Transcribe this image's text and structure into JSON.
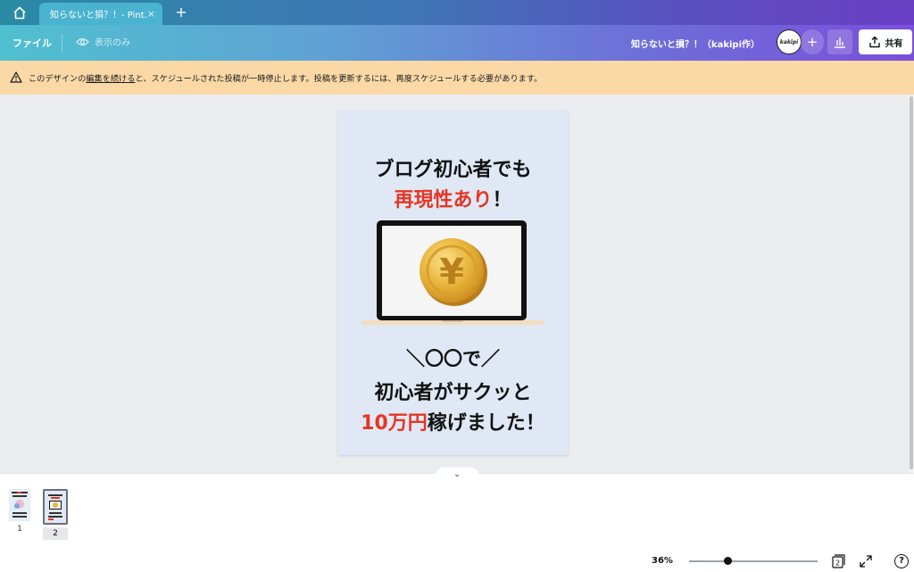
{
  "tabbar": {
    "tab_title": "知らないと損？！- Pint...",
    "tab_close": "×",
    "new_tab": "+"
  },
  "toolbar": {
    "file_label": "ファイル",
    "view_only_label": "表示のみ",
    "doc_title": "知らないと損？！（kakipi作）",
    "avatar_text": "kakipi",
    "add_collaborator": "+",
    "share_label": "共有"
  },
  "banner": {
    "text_before": "このデザインの",
    "link": "編集を続ける",
    "text_after": "と、スケジュールされた投稿が一時停止します。投稿を更新するには、再度スケジュールする必要があります。"
  },
  "design": {
    "line1": "ブログ初心者でも",
    "line2_red": "再現性あり",
    "line2_black": "！",
    "currency_symbol": "¥",
    "subline": "＼〇〇で／",
    "line3": "初心者がサクッと",
    "line4_red": "10万円",
    "line4_black": "稼げました！"
  },
  "pages": {
    "items": [
      {
        "number": "1"
      },
      {
        "number": "2"
      }
    ],
    "selected": "2"
  },
  "footer": {
    "zoom": "36%",
    "zoom_fraction": 0.3,
    "page_count": "2",
    "help": "?"
  },
  "colors": {
    "accent_red": "#e53524",
    "banner_bg": "#fbd9a6",
    "canvas_bg": "#ebecf0",
    "design_bg": "#dfe8f4"
  }
}
